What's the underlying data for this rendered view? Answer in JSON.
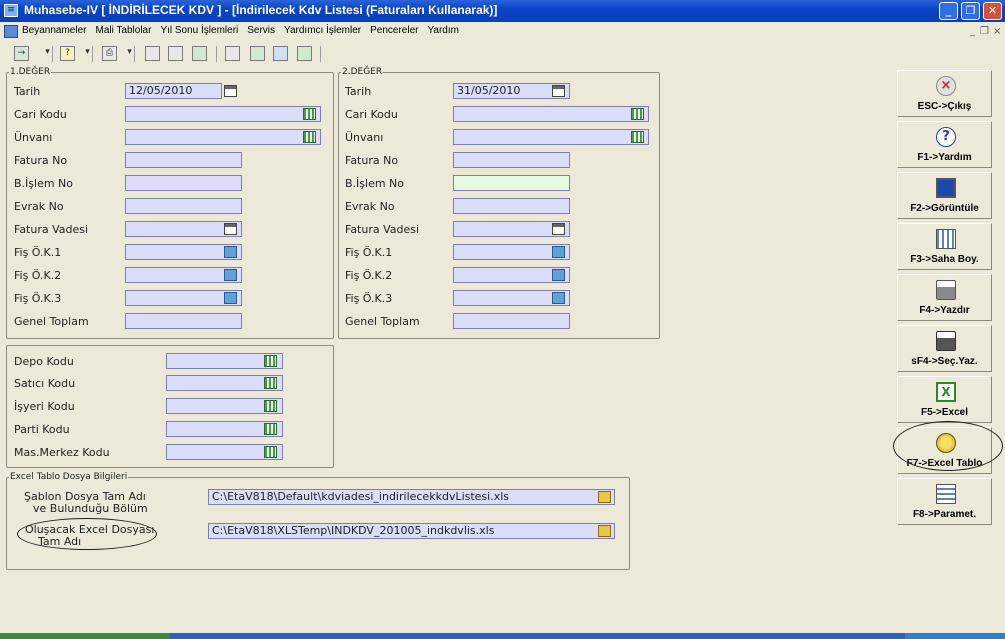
{
  "window": {
    "title": "Muhasebe-IV [ İNDİRİLECEK KDV ]  - [İndirilecek Kdv Listesi (Faturaları Kullanarak)]",
    "minimize": "_",
    "maximize": "❐",
    "close": "✕"
  },
  "menu": {
    "items": [
      "Beyannameler",
      "Mali Tablolar",
      "Yıl Sonu İşlemleri",
      "Servis",
      "Yardımcı İşlemler",
      "Pencereler",
      "Yardım"
    ],
    "mdi_min": "_",
    "mdi_restore": "❐",
    "mdi_close": "×"
  },
  "deger1": {
    "legend": "1.DEĞER",
    "labels": [
      "Tarih",
      "Cari Kodu",
      "Ünvanı",
      "Fatura No",
      "B.İşlem No",
      "Evrak No",
      "Fatura Vadesi",
      "Fiş Ö.K.1",
      "Fiş Ö.K.2",
      "Fiş Ö.K.3",
      "Genel Toplam"
    ],
    "tarih": "12/05/2010"
  },
  "deger2": {
    "legend": "2.DEĞER",
    "labels": [
      "Tarih",
      "Cari Kodu",
      "Ünvanı",
      "Fatura No",
      "B.İşlem No",
      "Evrak No",
      "Fatura Vadesi",
      "Fiş Ö.K.1",
      "Fiş Ö.K.2",
      "Fiş Ö.K.3",
      "Genel Toplam"
    ],
    "tarih": "31/05/2010"
  },
  "kodlar": {
    "labels": [
      "Depo Kodu",
      "Satıcı Kodu",
      "İşyeri Kodu",
      "Parti Kodu",
      "Mas.Merkez Kodu"
    ]
  },
  "excel": {
    "legend": "Excel Tablo Dosya Bilgileri",
    "sablon_label_1": "Şablon Dosya Tam Adı",
    "sablon_label_2": "ve Bulunduğu Bölüm",
    "sablon_value": "C:\\EtaV818\\Default\\kdviadesi_indirilecekkdvListesi.xls",
    "olusacak_label_1": "Oluşacak Excel Dosyası",
    "olusacak_label_2": "Tam Adı",
    "olusacak_value": "C:\\EtaV818\\XLSTemp\\INDKDV_201005_indkdvlis.xls"
  },
  "sidebar": {
    "buttons": [
      {
        "label": "ESC->Çıkış",
        "icon": "close-circle-icon"
      },
      {
        "label": "F1->Yardım",
        "icon": "help-icon"
      },
      {
        "label": "F2->Görüntüle",
        "icon": "monitor-icon"
      },
      {
        "label": "F3->Saha Boy.",
        "icon": "columns-icon"
      },
      {
        "label": "F4->Yazdır",
        "icon": "printer-icon"
      },
      {
        "label": "sF4->Seç.Yaz.",
        "icon": "select-print-icon"
      },
      {
        "label": "F5->Excel",
        "icon": "excel-icon"
      },
      {
        "label": "F7->Excel Tablo",
        "icon": "excel-table-gear-icon"
      },
      {
        "label": "F8->Paramet.",
        "icon": "parameters-icon"
      }
    ]
  },
  "colors": {
    "title_bar": "#0a44c8",
    "input_bg": "#dcdcfb",
    "input_highlight": "#e4fbe2",
    "form_bg": "#ece9d8"
  }
}
